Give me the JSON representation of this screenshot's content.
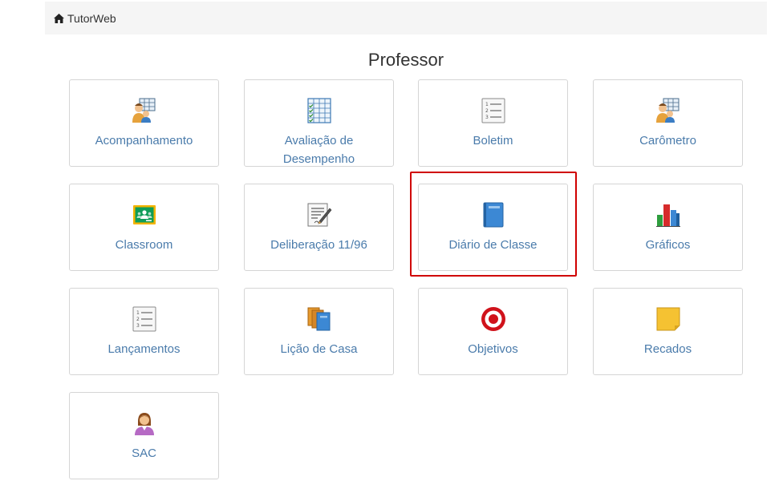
{
  "breadcrumb": {
    "label": "TutorWeb",
    "icon": "home-icon"
  },
  "page": {
    "title": "Professor"
  },
  "tiles": [
    {
      "label": "Acompanhamento",
      "icon": "teacher-board-icon"
    },
    {
      "label": "Avaliação de Desempenho",
      "icon": "checklist-grid-icon"
    },
    {
      "label": "Boletim",
      "icon": "numbered-list-icon"
    },
    {
      "label": "Carômetro",
      "icon": "teacher-board-icon"
    },
    {
      "label": "Classroom",
      "icon": "google-classroom-icon"
    },
    {
      "label": "Deliberação 11/96",
      "icon": "document-pen-icon"
    },
    {
      "label": "Diário de Classe",
      "icon": "blue-book-icon"
    },
    {
      "label": "Gráficos",
      "icon": "bar-chart-icon"
    },
    {
      "label": "Lançamentos",
      "icon": "numbered-list-icon"
    },
    {
      "label": "Lição de Casa",
      "icon": "books-icon"
    },
    {
      "label": "Objetivos",
      "icon": "target-icon"
    },
    {
      "label": "Recados",
      "icon": "sticky-note-icon"
    },
    {
      "label": "SAC",
      "icon": "support-agent-icon"
    }
  ],
  "highlight": {
    "target": "Diário de Classe",
    "color": "#d00000"
  },
  "colors": {
    "link": "#4a7bab",
    "breadcrumb_bg": "#f5f5f5"
  }
}
